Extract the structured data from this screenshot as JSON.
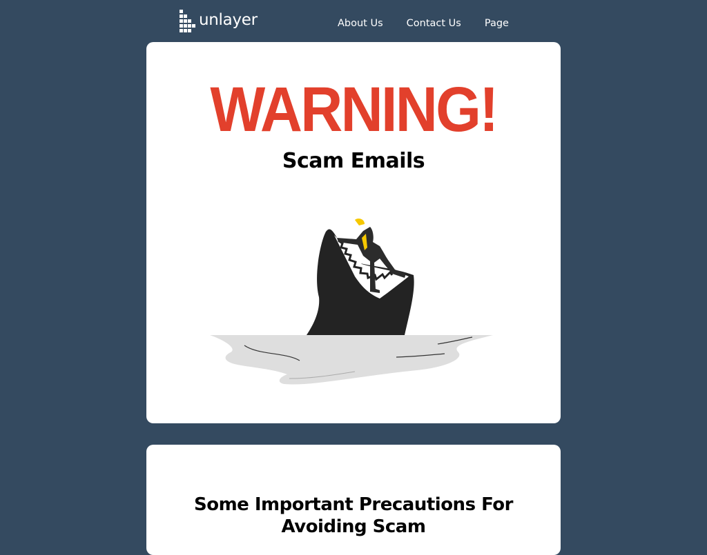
{
  "header": {
    "logo_text": "unlayer",
    "nav": [
      {
        "label": "About Us"
      },
      {
        "label": "Contact Us"
      },
      {
        "label": "Page"
      }
    ]
  },
  "hero": {
    "title": "WARNING!",
    "subtitle": "Scam Emails",
    "illustration_icon": "shark-attack-illustration"
  },
  "section2": {
    "title": "Some Important Precautions For Avoiding Scam"
  },
  "colors": {
    "background": "#344a60",
    "card": "#ffffff",
    "warning": "#e2402c",
    "text": "#000000"
  }
}
